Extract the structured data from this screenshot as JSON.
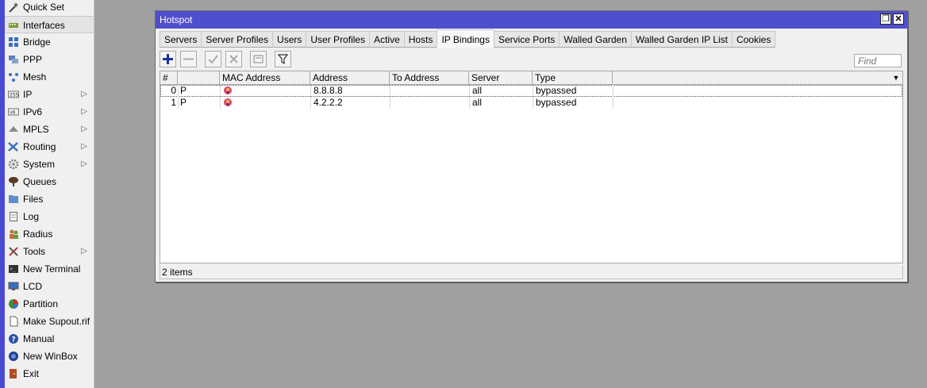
{
  "sidebar": {
    "items": [
      {
        "label": "Quick Set",
        "icon": "wand-icon",
        "arrow": false
      },
      {
        "label": "Interfaces",
        "icon": "interfaces-icon",
        "arrow": false
      },
      {
        "label": "Bridge",
        "icon": "bridge-icon",
        "arrow": false
      },
      {
        "label": "PPP",
        "icon": "ppp-icon",
        "arrow": false
      },
      {
        "label": "Mesh",
        "icon": "mesh-icon",
        "arrow": false
      },
      {
        "label": "IP",
        "icon": "ip-icon",
        "arrow": true
      },
      {
        "label": "IPv6",
        "icon": "ipv6-icon",
        "arrow": true
      },
      {
        "label": "MPLS",
        "icon": "mpls-icon",
        "arrow": true
      },
      {
        "label": "Routing",
        "icon": "routing-icon",
        "arrow": true
      },
      {
        "label": "System",
        "icon": "gear-icon",
        "arrow": true
      },
      {
        "label": "Queues",
        "icon": "queues-icon",
        "arrow": false
      },
      {
        "label": "Files",
        "icon": "folder-icon",
        "arrow": false
      },
      {
        "label": "Log",
        "icon": "log-icon",
        "arrow": false
      },
      {
        "label": "Radius",
        "icon": "users-icon",
        "arrow": false
      },
      {
        "label": "Tools",
        "icon": "tools-icon",
        "arrow": true
      },
      {
        "label": "New Terminal",
        "icon": "terminal-icon",
        "arrow": false
      },
      {
        "label": "LCD",
        "icon": "lcd-icon",
        "arrow": false
      },
      {
        "label": "Partition",
        "icon": "pie-icon",
        "arrow": false
      },
      {
        "label": "Make Supout.rif",
        "icon": "document-icon",
        "arrow": false
      },
      {
        "label": "Manual",
        "icon": "help-icon",
        "arrow": false
      },
      {
        "label": "New WinBox",
        "icon": "winbox-icon",
        "arrow": false
      },
      {
        "label": "Exit",
        "icon": "exit-icon",
        "arrow": false
      }
    ],
    "active_label": "Interfaces"
  },
  "window": {
    "title": "Hotspot",
    "maximize_glyph": "❐",
    "close_glyph": "✕",
    "tabs": [
      "Servers",
      "Server Profiles",
      "Users",
      "User Profiles",
      "Active",
      "Hosts",
      "IP Bindings",
      "Service Ports",
      "Walled Garden",
      "Walled Garden IP List",
      "Cookies"
    ],
    "active_tab": "IP Bindings",
    "find_placeholder": "Find",
    "columns": [
      "#",
      "",
      "MAC Address",
      "Address",
      "To Address",
      "Server",
      "Type"
    ],
    "rows": [
      {
        "num": "0",
        "flag": "P",
        "mac": "",
        "address": "8.8.8.8",
        "to_address": "",
        "server": "all",
        "type": "bypassed"
      },
      {
        "num": "1",
        "flag": "P",
        "mac": "",
        "address": "4.2.2.2",
        "to_address": "",
        "server": "all",
        "type": "bypassed"
      }
    ],
    "status": "2 items"
  },
  "colors": {
    "titlebar": "#4f4fce",
    "desktop": "#a0a0a0",
    "add_icon": "#1a2fa8"
  }
}
